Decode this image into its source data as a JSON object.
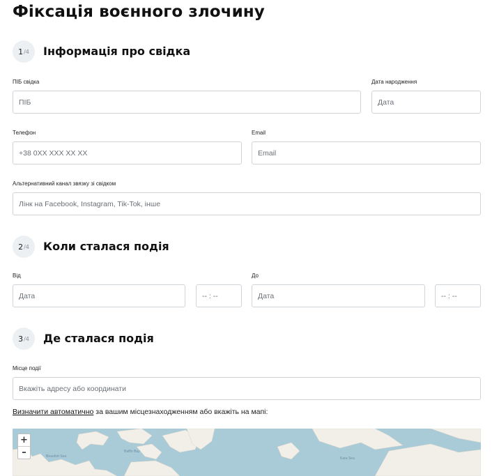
{
  "page": {
    "title": "Фіксація воєнного злочину"
  },
  "sections": [
    {
      "step": "1",
      "total": "/4",
      "title": "Інформація про свідка"
    },
    {
      "step": "2",
      "total": "/4",
      "title": "Коли сталася подія"
    },
    {
      "step": "3",
      "total": "/4",
      "title": "Де сталася подія"
    }
  ],
  "witness": {
    "name_label": "ПІБ свідка",
    "name_placeholder": "ПІБ",
    "dob_label": "Дата народження",
    "dob_placeholder": "Дата",
    "phone_label": "Телефон",
    "phone_placeholder": "+38 0XX XXX XX XX",
    "email_label": "Email",
    "email_placeholder": "Email",
    "alt_label": "Альтернативний канал звязку зі свідком",
    "alt_placeholder": "Лінк на Facebook, Instagram, Tik-Tok, інше"
  },
  "when": {
    "from_label": "Від",
    "from_date_placeholder": "Дата",
    "from_time_placeholder": "-- : --",
    "to_label": "До",
    "to_date_placeholder": "Дата",
    "to_time_placeholder": "-- : --"
  },
  "where": {
    "place_label": "Місце події",
    "place_placeholder": "Вкажіть адресу або координати",
    "auto_link": "Визначити автоматично",
    "helper_rest": " за вашим місцезнаходженням або вкажіть на мапі:"
  },
  "map": {
    "zoom_in": "+",
    "zoom_out": "–",
    "labels": [
      "Beaufort Sea",
      "Baffin Bay",
      "Kara Sea"
    ],
    "water_color": "#a9cbd8",
    "land_color": "#f2efe9"
  }
}
